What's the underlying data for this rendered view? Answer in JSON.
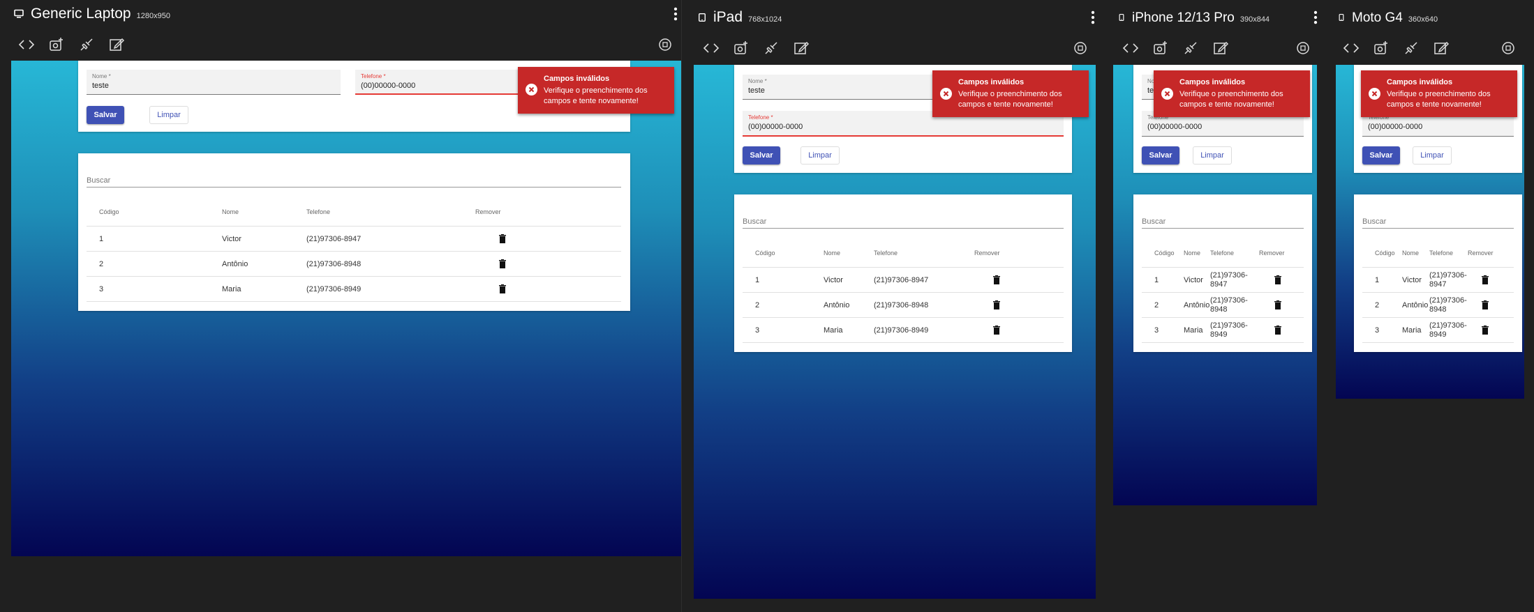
{
  "devices": [
    {
      "name": "Generic Laptop",
      "size": "1280x950"
    },
    {
      "name": "iPad",
      "size": "768x1024"
    },
    {
      "name": "iPhone 12/13 Pro",
      "size": "390x844"
    },
    {
      "name": "Moto G4",
      "size": "360x640"
    }
  ],
  "form": {
    "nome_label": "Nome *",
    "nome_value": "teste",
    "telefone_label": "Telefone *",
    "telefone_value": "(00)00000-0000",
    "save_label": "Salvar",
    "clear_label": "Limpar"
  },
  "search": {
    "placeholder": "Buscar"
  },
  "table": {
    "headers": [
      "Código",
      "Nome",
      "Telefone",
      "Remover"
    ],
    "rows": [
      {
        "codigo": "1",
        "nome": "Victor",
        "telefone": "(21)97306-8947"
      },
      {
        "codigo": "2",
        "nome": "Antônio",
        "telefone": "(21)97306-8948"
      },
      {
        "codigo": "3",
        "nome": "Maria",
        "telefone": "(21)97306-8949"
      }
    ],
    "narrow_rows": [
      {
        "tel_a": "(21)97306-",
        "tel_b": "8947"
      },
      {
        "tel_a": "(21)97306-",
        "tel_b": "8948"
      },
      {
        "tel_a": "(21)97306-",
        "tel_b": "8949"
      }
    ]
  },
  "toast": {
    "title": "Campos inválidos",
    "message": "Verifique o preenchimento dos campos e tente novamente!"
  },
  "icons": {
    "device": "monitor-icon / tablet-icon / phone-icon",
    "toolbar": [
      "code-icon",
      "screenshot-icon",
      "connect-icon",
      "edit-icon"
    ],
    "rotate": "rotate-icon",
    "remove": "trash-icon",
    "toast": "error-circle-icon"
  },
  "colors": {
    "primary": "#3f51b5",
    "error": "#c62828",
    "gradient_top": "#27b7d6",
    "gradient_bottom": "#030552",
    "chrome_bg": "#202020"
  }
}
